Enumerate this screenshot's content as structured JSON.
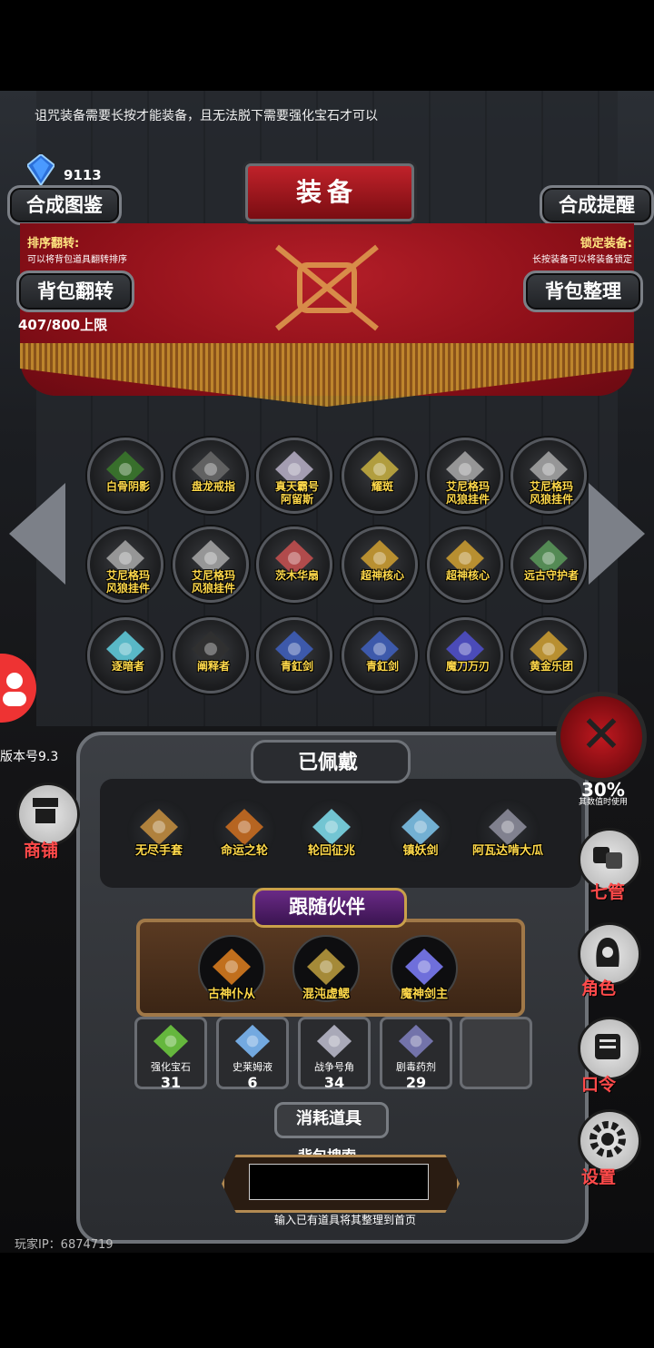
{
  "tip": "诅咒装备需要长按才能装备，且无法脱下需要强化宝石才可以",
  "currency": {
    "amount": "9113",
    "icon": "blue-gem-icon"
  },
  "header": {
    "title": "装备",
    "atlas_button": "合成图鉴",
    "reminder_button": "合成提醒"
  },
  "sort_note": {
    "title": "排序翻转:",
    "desc": "可以将背包道具翻转排序"
  },
  "lock_note": {
    "title": "锁定装备:",
    "desc": "长按装备可以将装备锁定"
  },
  "flip_button": "背包翻转",
  "sort_button": "背包整理",
  "capacity": "407/800上限",
  "inventory": [
    {
      "name": "白骨阴影",
      "icon": "bone-flower-icon",
      "color": "#3a7a2a"
    },
    {
      "name": "盘龙戒指",
      "icon": "dragon-ring-icon",
      "color": "#6a6a6a"
    },
    {
      "name": "真天霸号\n阿留斯",
      "icon": "armored-knight-icon",
      "color": "#b8b0c8"
    },
    {
      "name": "耀斑",
      "icon": "flare-gun-icon",
      "color": "#c8b040"
    },
    {
      "name": "艾尼格玛\n风狼挂件",
      "icon": "wolf-pendant-icon",
      "color": "#a8a8a8"
    },
    {
      "name": "艾尼格玛\n风狼挂件",
      "icon": "wolf-pendant-icon",
      "color": "#a8a8a8"
    },
    {
      "name": "艾尼格玛\n风狼挂件",
      "icon": "wolf-pendant-icon",
      "color": "#a8a8a8"
    },
    {
      "name": "艾尼格玛\n风狼挂件",
      "icon": "wolf-pendant-icon",
      "color": "#a8a8a8"
    },
    {
      "name": "茨木华扇",
      "icon": "red-hair-girl-icon",
      "color": "#c85050"
    },
    {
      "name": "超神核心",
      "icon": "core-orb-icon",
      "color": "#d0a030"
    },
    {
      "name": "超神核心",
      "icon": "core-orb-icon",
      "color": "#d0a030"
    },
    {
      "name": "远古守护者",
      "icon": "leaf-guardian-icon",
      "color": "#5a9a5a"
    },
    {
      "name": "逐暗者",
      "icon": "cyan-sword-icon",
      "color": "#60d0e0"
    },
    {
      "name": "阐释者",
      "icon": "black-sword-icon",
      "color": "#303030"
    },
    {
      "name": "青釭剑",
      "icon": "blue-sword-icon",
      "color": "#4060c0"
    },
    {
      "name": "青釭剑",
      "icon": "blue-sword-icon",
      "color": "#4060c0"
    },
    {
      "name": "魔刀万刃",
      "icon": "purple-blade-icon",
      "color": "#5050d0"
    },
    {
      "name": "黄金乐团",
      "icon": "golden-harp-icon",
      "color": "#d0a030"
    }
  ],
  "worn": {
    "title": "已佩戴",
    "items": [
      {
        "name": "无尽手套",
        "icon": "infinity-gauntlet-icon",
        "color": "#c89040"
      },
      {
        "name": "命运之轮",
        "icon": "fate-wheel-icon",
        "color": "#d07020"
      },
      {
        "name": "轮回征兆",
        "icon": "crystal-staff-icon",
        "color": "#80e0f0"
      },
      {
        "name": "镇妖剑",
        "icon": "ice-sword-icon",
        "color": "#80c8f0"
      },
      {
        "name": "阿瓦达啃大瓜",
        "icon": "scepter-icon",
        "color": "#9090a0"
      }
    ]
  },
  "companions": {
    "title": "跟随伙伴",
    "items": [
      {
        "name": "古神仆从",
        "icon": "dark-servant-icon",
        "color": "#e08020"
      },
      {
        "name": "混沌虚鳃",
        "icon": "chaos-mask-icon",
        "color": "#c0a040"
      },
      {
        "name": "魔神剑主",
        "icon": "demon-swordmaster-icon",
        "color": "#8080ff"
      }
    ]
  },
  "consumables": {
    "title": "消耗道具",
    "items": [
      {
        "name": "强化宝石",
        "count": "31",
        "icon": "green-gem-icon",
        "color": "#70d040"
      },
      {
        "name": "史莱姆液",
        "count": "6",
        "icon": "potion-bottle-icon",
        "color": "#80c0ff"
      },
      {
        "name": "战争号角",
        "count": "34",
        "icon": "war-horn-icon",
        "color": "#c0c0d0"
      },
      {
        "name": "剧毒药剂",
        "count": "29",
        "icon": "poison-flask-icon",
        "color": "#8080c0"
      }
    ]
  },
  "search": {
    "title": "背包搜索",
    "value": "",
    "hint": "输入已有道具将其整理到首页"
  },
  "player_ip": "玩家IP：6874719",
  "version": "版本号9.3",
  "side_menu": {
    "shop": "商铺",
    "manage": "七管",
    "character": "角色",
    "password": "口令",
    "settings": "设置",
    "percent": "30%",
    "percent_desc": "其数值时使用"
  }
}
